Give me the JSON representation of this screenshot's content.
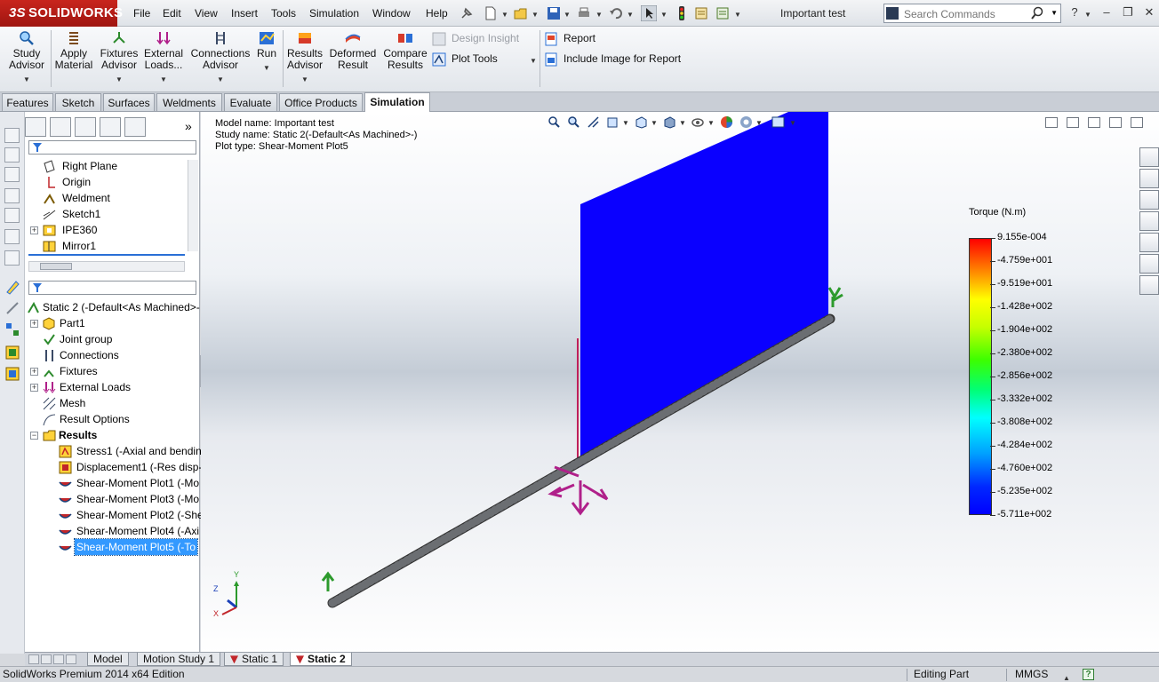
{
  "app": {
    "logo_text": "SOLIDWORKS",
    "document_title": "Important test"
  },
  "menu": [
    "File",
    "Edit",
    "View",
    "Insert",
    "Tools",
    "Simulation",
    "Window",
    "Help"
  ],
  "search": {
    "placeholder": "Search Commands"
  },
  "command_manager": {
    "buttons": [
      {
        "line1": "Study",
        "line2": "Advisor"
      },
      {
        "line1": "Apply",
        "line2": "Material"
      },
      {
        "line1": "Fixtures",
        "line2": "Advisor"
      },
      {
        "line1": "External",
        "line2": "Loads..."
      },
      {
        "line1": "Connections",
        "line2": "Advisor"
      },
      {
        "line1": "Run",
        "line2": ""
      },
      {
        "line1": "Results",
        "line2": "Advisor"
      },
      {
        "line1": "Deformed",
        "line2": "Result"
      },
      {
        "line1": "Compare",
        "line2": "Results"
      }
    ],
    "design_insight": "Design Insight",
    "plot_tools": "Plot Tools",
    "report": "Report",
    "include_image": "Include Image for Report"
  },
  "tabs": [
    "Features",
    "Sketch",
    "Surfaces",
    "Weldments",
    "Evaluate",
    "Office Products",
    "Simulation"
  ],
  "active_tab": "Simulation",
  "feature_tree": {
    "items": [
      "Right Plane",
      "Origin",
      "Weldment",
      "Sketch1",
      "IPE360",
      "Mirror1"
    ]
  },
  "sim_tree": {
    "study": "Static 2 (-Default<As Machined>-",
    "items": [
      "Part1",
      "Joint group",
      "Connections",
      "Fixtures",
      "External Loads",
      "Mesh",
      "Result Options"
    ],
    "results_label": "Results",
    "results": [
      "Stress1 (-Axial and bendin",
      "Displacement1 (-Res disp-",
      "Shear-Moment Plot1 (-Mo",
      "Shear-Moment Plot3 (-Mo",
      "Shear-Moment Plot2 (-She",
      "Shear-Moment Plot4 (-Axi",
      "Shear-Moment Plot5 (-To"
    ]
  },
  "plot_info": {
    "model_name": "Model name: Important test",
    "study_name": "Study name: Static 2(-Default<As Machined>-)",
    "plot_type": "Plot type:  Shear-Moment Plot5"
  },
  "legend": {
    "title": "Torque (N.m)",
    "labels": [
      "9.155e-004",
      "-4.759e+001",
      "-9.519e+001",
      "-1.428e+002",
      "-1.904e+002",
      "-2.380e+002",
      "-2.856e+002",
      "-3.332e+002",
      "-3.808e+002",
      "-4.284e+002",
      "-4.760e+002",
      "-5.235e+002",
      "-5.711e+002"
    ],
    "colors": {
      "max": "#ff0000",
      "min": "#0000ff"
    }
  },
  "triad": {
    "y": "Y",
    "z": "Z",
    "x": "X"
  },
  "bottom_tabs": [
    "Model",
    "Motion Study 1",
    "Static 1",
    "Static 2"
  ],
  "active_bottom_tab": "Static 2",
  "status": {
    "edition": "SolidWorks Premium 2014 x64 Edition",
    "mode": "Editing Part",
    "units": "MMGS",
    "help": "?"
  }
}
